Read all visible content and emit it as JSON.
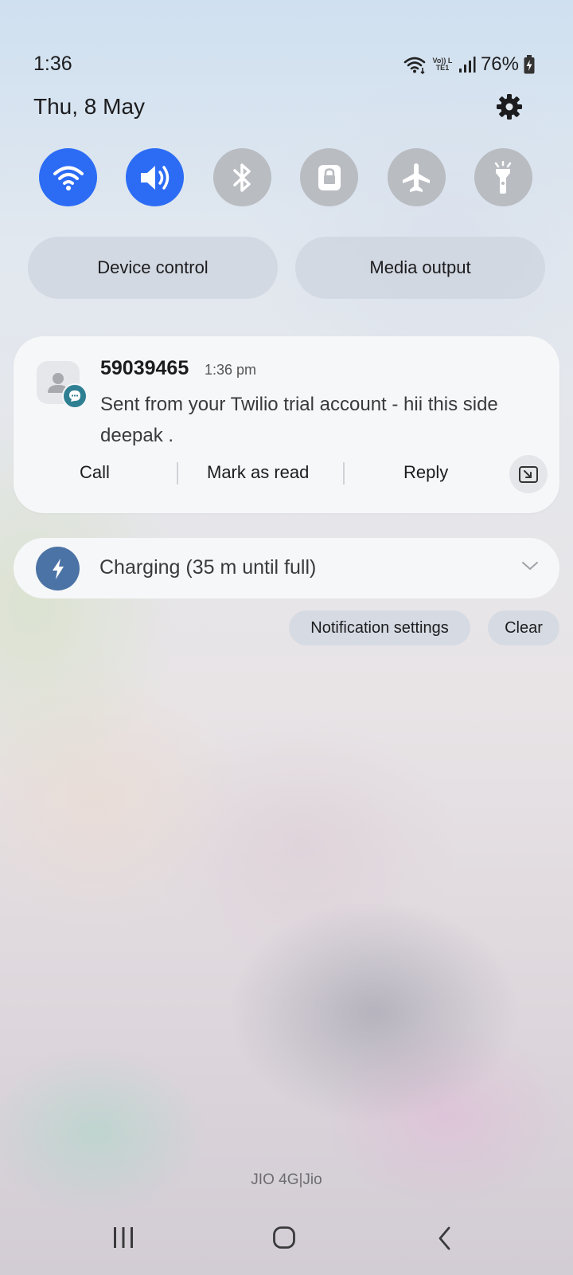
{
  "status_bar": {
    "time": "1:36",
    "battery_percent": "76%",
    "volte_label": "Vo)) LTE1"
  },
  "header": {
    "date": "Thu, 8 May"
  },
  "quick_tiles": [
    {
      "name": "wifi",
      "icon": "wifi-icon",
      "state": "on"
    },
    {
      "name": "sound",
      "icon": "volume-icon",
      "state": "on"
    },
    {
      "name": "bluetooth",
      "icon": "bluetooth-icon",
      "state": "off"
    },
    {
      "name": "rotation-lock",
      "icon": "lock-icon",
      "state": "off"
    },
    {
      "name": "airplane-mode",
      "icon": "airplane-icon",
      "state": "off"
    },
    {
      "name": "flashlight",
      "icon": "flashlight-icon",
      "state": "off"
    }
  ],
  "pills": {
    "device_control": "Device control",
    "media_output": "Media output"
  },
  "notification": {
    "sender": "59039465",
    "time": "1:36 pm",
    "body": "Sent from your Twilio trial account - hii this side deepak .",
    "actions": {
      "call": "Call",
      "mark_read": "Mark as read",
      "reply": "Reply"
    }
  },
  "charging": {
    "text": "Charging (35 m until full)"
  },
  "footer": {
    "notification_settings": "Notification settings",
    "clear": "Clear"
  },
  "carrier": "JIO 4G|Jio",
  "colors": {
    "active_tile": "#2c6cf5",
    "inactive_tile": "#b9bcc1",
    "charge_icon": "#4b73a5",
    "message_badge": "#2f7f93"
  }
}
